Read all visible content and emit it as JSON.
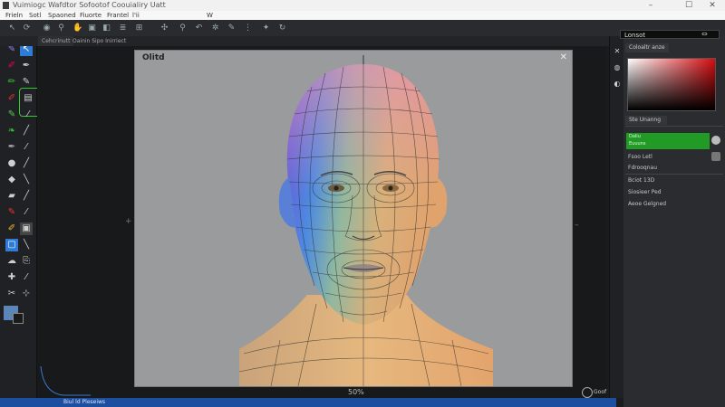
{
  "window": {
    "title": "Vuimiogc Wafdtor Sofootof Coouialiry Uatt",
    "controls": [
      "–",
      "☐",
      "✕"
    ]
  },
  "menu": [
    "Frieln",
    "Sotl",
    "Spaoned",
    "Fiuorte",
    "Frantel",
    "l'ii",
    "W"
  ],
  "tabs": [
    "Cehcrinutt",
    "Oainin Sipo Inirriect"
  ],
  "canvas": {
    "label": "Olitd",
    "close": "✕",
    "zoom": "50%"
  },
  "search": {
    "value": "Lonsot"
  },
  "panel": {
    "color_tab": "Coloaltr anze",
    "layers_tab": "Ste Unanng",
    "green_label_1": "Daliu",
    "green_label_2": "Euuuns",
    "props": [
      "Fsoo Letl",
      "Fdrooqnau",
      "Bciot 13D",
      "Siosieer Ped",
      "Aeoe Gelgned"
    ]
  },
  "status": {
    "text": "Biul ld Pleseiws"
  },
  "bottom_right": "Goof",
  "colors": {
    "accent_green": "#219a26",
    "status_blue": "#1d4fa0",
    "picker_red": "#d50c10"
  }
}
